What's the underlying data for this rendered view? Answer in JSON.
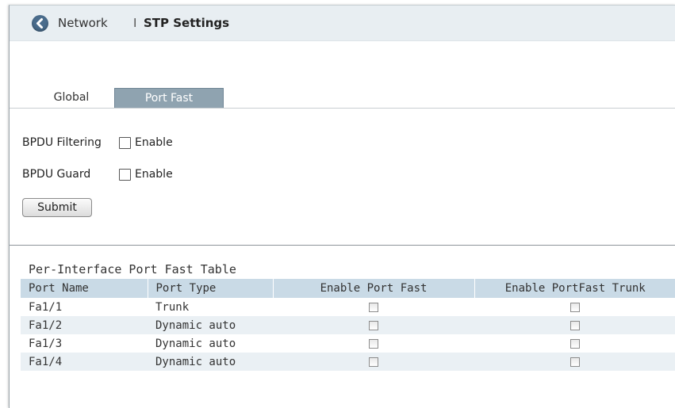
{
  "header": {
    "back_icon": "back-arrow-icon",
    "breadcrumb_parent": "Network",
    "separator": "I",
    "title": "STP Settings"
  },
  "tabs": [
    {
      "label": "Global",
      "active": false
    },
    {
      "label": "Port Fast",
      "active": true
    }
  ],
  "bpdu_filtering": {
    "label": "BPDU Filtering",
    "checkbox_label": "Enable",
    "checked": false
  },
  "bpdu_guard": {
    "label": "BPDU Guard",
    "checkbox_label": "Enable",
    "checked": false
  },
  "submit_label": "Submit",
  "table": {
    "title": "Per-Interface Port Fast Table",
    "columns": [
      "Port Name",
      "Port Type",
      "Enable Port Fast",
      "Enable PortFast Trunk"
    ],
    "rows": [
      {
        "port": "Fa1/1",
        "type": "Trunk",
        "port_fast": false,
        "portfast_trunk": false
      },
      {
        "port": "Fa1/2",
        "type": "Dynamic auto",
        "port_fast": false,
        "portfast_trunk": false
      },
      {
        "port": "Fa1/3",
        "type": "Dynamic auto",
        "port_fast": false,
        "portfast_trunk": false
      },
      {
        "port": "Fa1/4",
        "type": "Dynamic auto",
        "port_fast": false,
        "portfast_trunk": false
      }
    ]
  },
  "colors": {
    "header_bg": "#e8eef2",
    "active_tab_bg": "#8fa3b0",
    "table_header_bg": "#c9dae6",
    "row_alt_bg": "#eaf0f4"
  }
}
